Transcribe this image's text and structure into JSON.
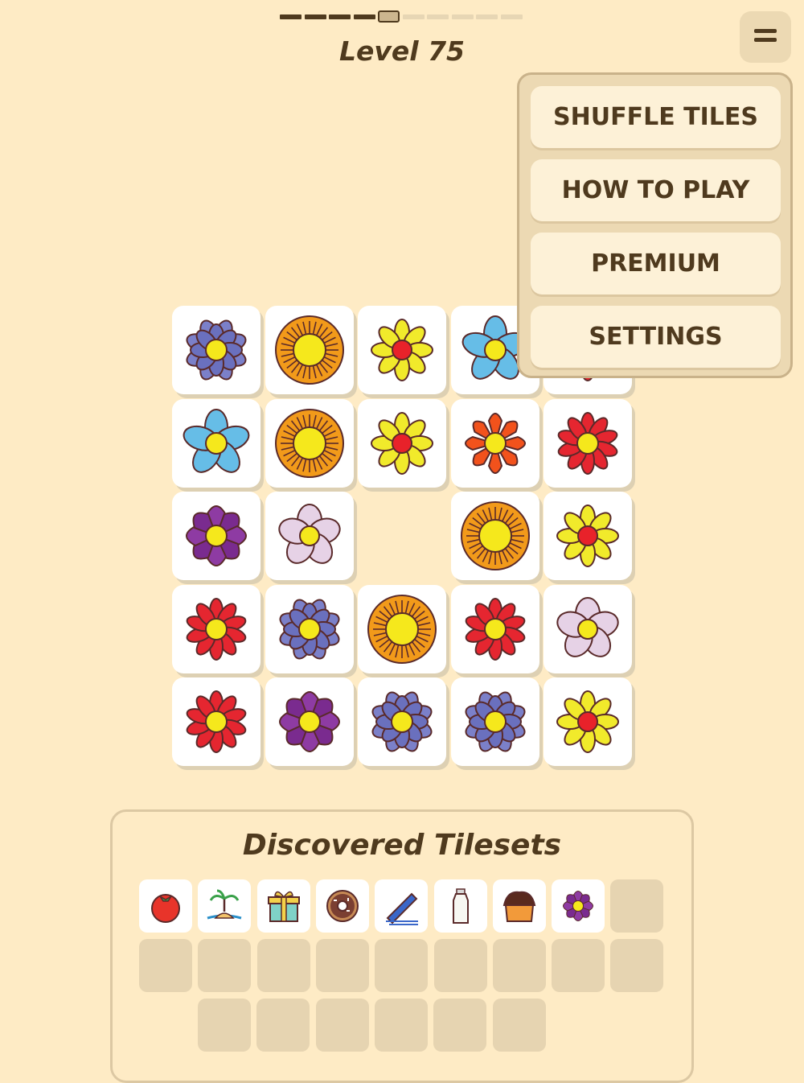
{
  "level": {
    "title": "Level 75",
    "progress": {
      "completed": 4,
      "current": 5,
      "total": 10
    }
  },
  "menu": {
    "items": [
      {
        "id": "shuffle",
        "label": "SHUFFLE TILES"
      },
      {
        "id": "howto",
        "label": "HOW TO PLAY"
      },
      {
        "id": "premium",
        "label": "PREMIUM"
      },
      {
        "id": "settings",
        "label": "SETTINGS"
      }
    ]
  },
  "board": {
    "rows": [
      [
        "blue-daisy",
        "orange-sunflower",
        "yellow-daisy",
        "sky-blue-flower",
        "red-daisy"
      ],
      [
        "sky-blue-flower",
        "orange-sunflower",
        "yellow-daisy",
        "orange-star-flower",
        "red-daisy"
      ],
      [
        "purple-lotus",
        "pink-blossom",
        null,
        "orange-sunflower",
        "yellow-daisy"
      ],
      [
        "red-daisy",
        "blue-daisy",
        "orange-sunflower",
        "red-daisy",
        "pink-blossom"
      ],
      [
        "red-daisy",
        "purple-lotus",
        "blue-daisy",
        "blue-daisy",
        "yellow-daisy"
      ]
    ],
    "hidden_by_menu": "tile at row 1, columns 4-5 partly covered"
  },
  "tilesets": {
    "title": "Discovered Tilesets",
    "discovered": [
      "tomato-icon",
      "island-icon",
      "gift-icon",
      "donut-icon",
      "pencil-icon",
      "milk-bottle-icon",
      "cake-icon",
      "purple-flower-icon"
    ],
    "total_slots": 24
  },
  "colors": {
    "background": "#feebc5",
    "text": "#4f3a1e",
    "tile": "#ffffff"
  }
}
